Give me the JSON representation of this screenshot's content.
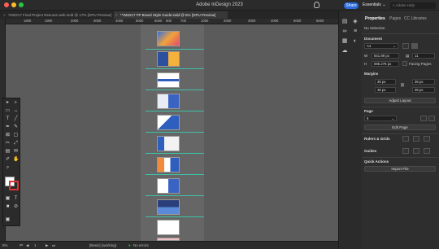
{
  "app": {
    "title": "Adobe InDesign 2023",
    "share_label": "Share",
    "workspace": "Essentials",
    "search_placeholder": "Adobe Help"
  },
  "tabs": [
    {
      "label": "YM2217 Final Project Resume web.indd @ 17% [GPU Preview]",
      "active": false
    },
    {
      "label": "*YM2217 FP Brand Style Guide.indd @ 5% [GPU Preview]",
      "active": true
    }
  ],
  "ruler_ticks": [
    "1800",
    "1900",
    "2000",
    "3000",
    "4000",
    "5000",
    "6000",
    "600",
    "700",
    "1000",
    "2000",
    "3000",
    "4000",
    "5000",
    "6000"
  ],
  "statusbar": {
    "zoom": "5%",
    "page": "1",
    "style": "[Basic] (working)",
    "errors": "No errors"
  },
  "panel": {
    "tabs": [
      "Properties",
      "Pages",
      "CC Libraries"
    ],
    "selection": "No Selection",
    "document_label": "Document",
    "preset": "A4",
    "width": "841.89 px",
    "height": "595.276 px",
    "pages_count": "11",
    "facing_pages": "Facing Pages",
    "margins_label": "Margins",
    "margin_top": "36 px",
    "margin_bottom": "36 px",
    "margin_left": "36 px",
    "margin_right": "36 px",
    "adjust_layout": "Adjust Layout",
    "page_label": "Page",
    "page_value": "6",
    "edit_page": "Edit Page",
    "rulers_grids": "Rulers & Grids",
    "guides": "Guides",
    "quick_actions": "Quick Actions",
    "import_file": "Import File"
  },
  "colors": {
    "accent": "#2a6cdb",
    "guide": "#3cc2a8",
    "canvas": "#5b5b5b"
  }
}
